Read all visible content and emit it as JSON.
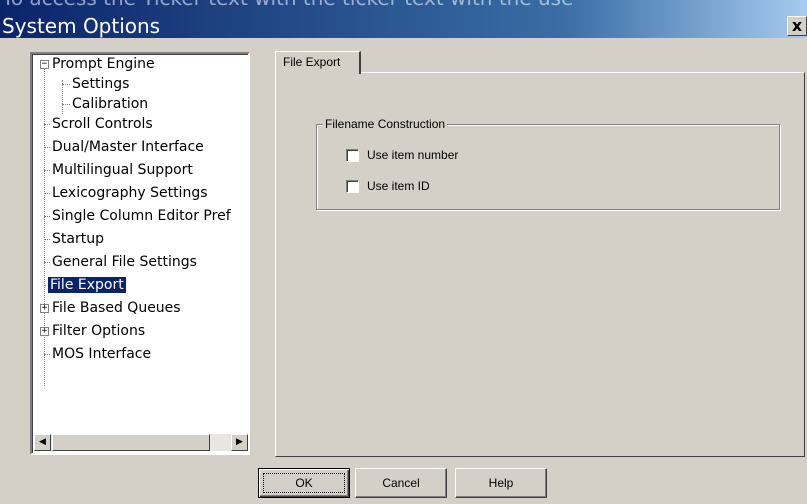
{
  "window": {
    "title": "System Options",
    "ghost_text": "To access the Ticker text with the ticker text with the use",
    "close_label": "x"
  },
  "tree": {
    "items": [
      {
        "label": "Prompt Engine",
        "level": 0,
        "expander": "minus"
      },
      {
        "label": "Settings",
        "level": 1
      },
      {
        "label": "Calibration",
        "level": 1
      },
      {
        "label": "Scroll Controls",
        "level": 0
      },
      {
        "label": "Dual/Master Interface",
        "level": 0
      },
      {
        "label": "Multilingual Support",
        "level": 0
      },
      {
        "label": "Lexicography Settings",
        "level": 0
      },
      {
        "label": "Single Column Editor Pref",
        "level": 0
      },
      {
        "label": "Startup",
        "level": 0
      },
      {
        "label": "General File Settings",
        "level": 0
      },
      {
        "label": "File Export",
        "level": 0,
        "selected": true
      },
      {
        "label": "File Based Queues",
        "level": 0,
        "expander": "plus"
      },
      {
        "label": "Filter Options",
        "level": 0,
        "expander": "plus"
      },
      {
        "label": "MOS Interface",
        "level": 0
      }
    ],
    "scroll_left_icon": "◀",
    "scroll_right_icon": "▶"
  },
  "tabs": [
    {
      "label": "File Export",
      "active": true
    }
  ],
  "group": {
    "label": "Filename Construction",
    "options": [
      {
        "label": "Use item number",
        "checked": false
      },
      {
        "label": "Use item ID",
        "checked": false
      }
    ]
  },
  "buttons": {
    "ok": "OK",
    "cancel": "Cancel",
    "help": "Help"
  }
}
